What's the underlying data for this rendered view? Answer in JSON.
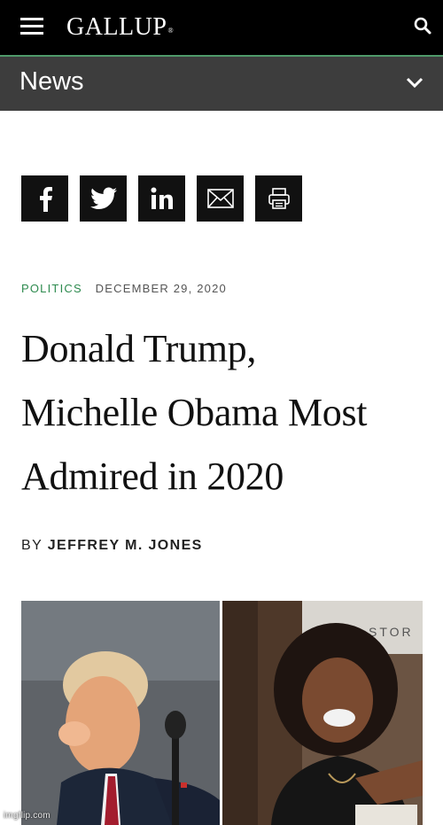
{
  "header": {
    "logo_text": "GALLUP",
    "logo_mark": "®",
    "menu_icon": "hamburger-menu-icon",
    "search_icon": "search-icon"
  },
  "section_bar": {
    "label": "News",
    "icon": "chevron-down-icon"
  },
  "share": {
    "buttons": [
      {
        "icon": "facebook-icon"
      },
      {
        "icon": "twitter-icon"
      },
      {
        "icon": "linkedin-icon"
      },
      {
        "icon": "email-icon"
      },
      {
        "icon": "print-icon"
      }
    ]
  },
  "article": {
    "category": "POLITICS",
    "date": "DECEMBER 29, 2020",
    "headline_lines": [
      "Donald Trump,",
      "Michelle Obama Most",
      "Admired in 2020"
    ],
    "byline_prefix": "BY",
    "author": "JEFFREY M. JONES"
  },
  "photo": {
    "store_sign_text": "STOR",
    "watermark": "imgflip.com"
  },
  "colors": {
    "topbar": "#000000",
    "accent_line": "#4f9a6a",
    "section_bar": "#3d3d3d",
    "category": "#2d8a4e",
    "share_button": "#111111"
  }
}
